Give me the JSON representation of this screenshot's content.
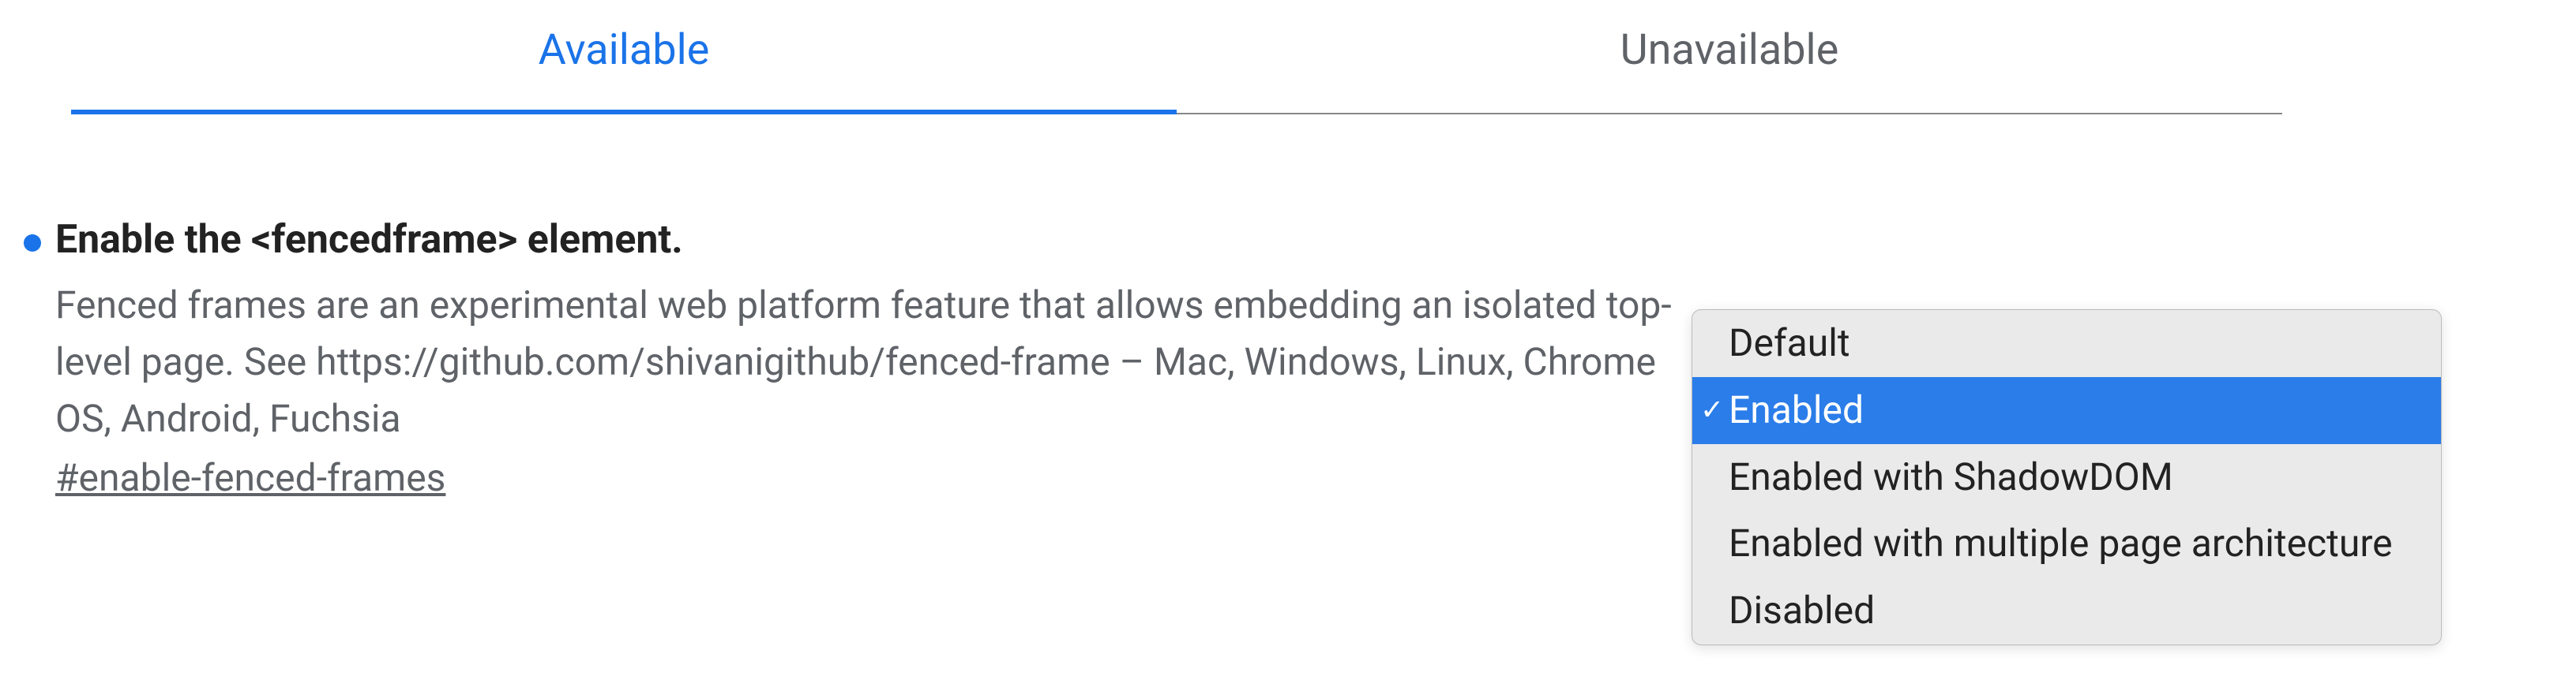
{
  "tabs": {
    "available": "Available",
    "unavailable": "Unavailable"
  },
  "flag": {
    "title": "Enable the <fencedframe> element.",
    "description": "Fenced frames are an experimental web platform feature that allows embedding an isolated top-level page. See https://github.com/shivanigithub/fenced-frame – Mac, Windows, Linux, Chrome OS, Android, Fuchsia",
    "anchor": "#enable-fenced-frames"
  },
  "dropdown": {
    "options": [
      "Default",
      "Enabled",
      "Enabled with ShadowDOM",
      "Enabled with multiple page architecture",
      "Disabled"
    ],
    "selected_index": 1
  }
}
